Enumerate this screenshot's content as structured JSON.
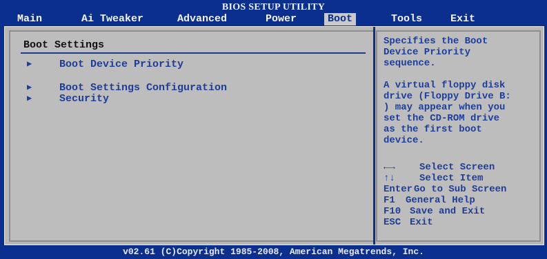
{
  "window": {
    "title": "BIOS SETUP UTILITY"
  },
  "menu": {
    "items": [
      {
        "label": "Main"
      },
      {
        "label": "Ai Tweaker"
      },
      {
        "label": "Advanced"
      },
      {
        "label": "Power"
      },
      {
        "label": "Boot",
        "active": true
      },
      {
        "label": "Tools"
      },
      {
        "label": "Exit"
      }
    ]
  },
  "left_panel": {
    "section_title": "Boot Settings",
    "items": [
      {
        "label": "Boot Device Priority",
        "icon": "submenu-arrow-icon"
      },
      {
        "label": "Boot Settings Configuration",
        "icon": "submenu-arrow-icon"
      },
      {
        "label": "Security",
        "icon": "submenu-arrow-icon"
      }
    ]
  },
  "right_panel": {
    "help_lines": [
      "Specifies the Boot",
      "Device Priority",
      "sequence."
    ],
    "note_lines": [
      "A virtual floppy disk",
      "drive (Floppy Drive B:",
      ") may appear when you",
      "set the CD-ROM drive",
      "as the first boot",
      "device."
    ],
    "keys": [
      {
        "key": "←→",
        "desc": "Select Screen",
        "icon": "left-right-arrows-icon"
      },
      {
        "key": "↑↓",
        "desc": "Select Item",
        "icon": "up-down-arrows-icon"
      },
      {
        "key": "Enter",
        "desc": "Go to Sub Screen"
      },
      {
        "key": "F1",
        "desc": "General Help"
      },
      {
        "key": "F10",
        "desc": "Save and Exit"
      },
      {
        "key": "ESC",
        "desc": "Exit"
      }
    ]
  },
  "footer": {
    "text": "v02.61 (C)Copyright 1985-2008, American Megatrends, Inc."
  },
  "colors": {
    "frame_blue": "#0b2f8f",
    "panel_gray": "#bdbdbd",
    "text_blue": "#1e3d99",
    "header_white": "#f2f5ff",
    "active_tab_gray": "#c9c9c9"
  }
}
